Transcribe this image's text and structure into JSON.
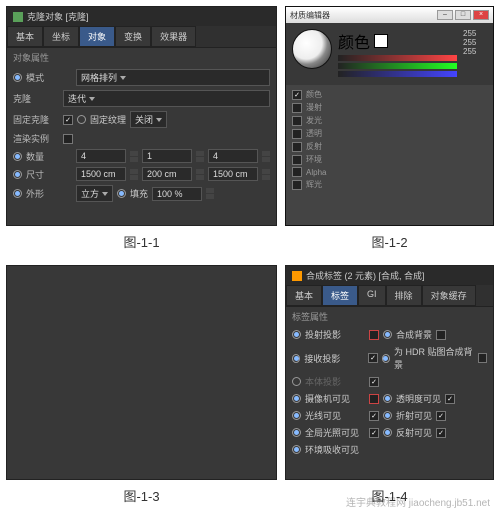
{
  "p1": {
    "title": "克隆对象 [克隆]",
    "tabs": [
      "基本",
      "坐标",
      "对象",
      "变换",
      "效果器"
    ],
    "active": 2,
    "section": "对象属性",
    "mode_lbl": "模式",
    "mode_val": "网格排列",
    "clone_lbl": "克隆",
    "clone_val": "迭代",
    "fix_lbl": "固定克隆",
    "fixtex_lbl": "固定纹理",
    "fixtex_val": "关闭",
    "inst_lbl": "渲染实例",
    "count_lbl": "数量",
    "c1": "4",
    "c2": "1",
    "c3": "4",
    "size_lbl": "尺寸",
    "s1": "1500 cm",
    "s2": "200 cm",
    "s3": "1500 cm",
    "shape_lbl": "外形",
    "shape_val": "立方",
    "fill_lbl": "填充",
    "fill_val": "100 %",
    "caption": "图-1-1"
  },
  "p2": {
    "wintitle": "材质编辑器",
    "channel": "颜色",
    "v255": "255",
    "rows": [
      "颜色",
      "漫射",
      "发光",
      "透明",
      "反射",
      "环境",
      "Alpha",
      "辉光"
    ],
    "caption": "图-1-2"
  },
  "p3": {
    "caption": "图-1-3"
  },
  "p4": {
    "title": "合成标签 (2 元素) [合成, 合成]",
    "tabs": [
      "基本",
      "标签",
      "GI",
      "排除",
      "对象缓存"
    ],
    "active": 1,
    "section": "标签属性",
    "r1a": "投射投影",
    "r1b": "合成背景",
    "r2a": "接收投影",
    "r2b": "为 HDR 贴图合成背景",
    "r3": "本体投影",
    "r4a": "摄像机可见",
    "r4b": "透明度可见",
    "r5a": "光线可见",
    "r5b": "折射可见",
    "r6a": "全局光照可见",
    "r6b": "反射可见",
    "r7": "环境吸收可见",
    "caption": "图-1-4",
    "wm": "连宇典教程网 jiaocheng.jb51.net"
  }
}
